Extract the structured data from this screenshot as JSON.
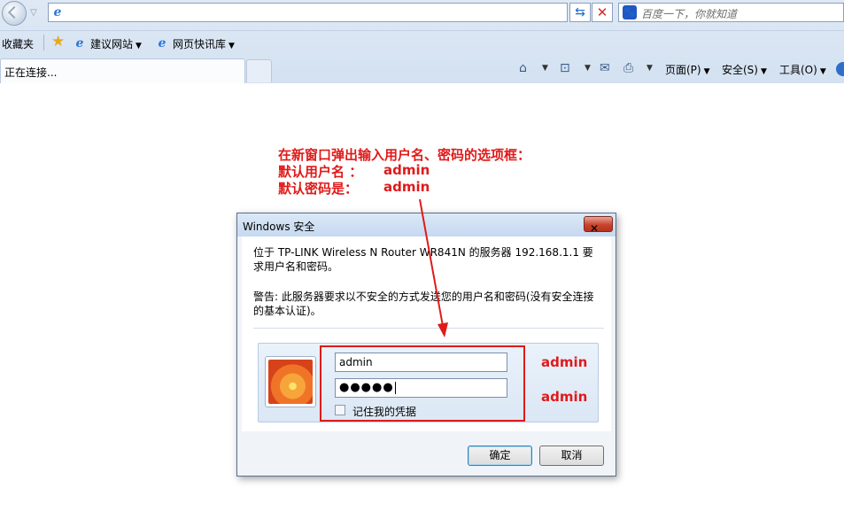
{
  "browser": {
    "address_value": "",
    "search_placeholder": "百度一下，你就知道",
    "favorites": {
      "favorites_label": "收藏夹",
      "items": [
        "建议网站",
        "网页快讯库"
      ]
    },
    "tab_label": "正在连接...",
    "command_bar": {
      "page_label": "页面(P)",
      "safety_label": "安全(S)",
      "tools_label": "工具(O)"
    }
  },
  "annotation": {
    "line1": "在新窗口弹出输入用户名、密码的选项框：",
    "line2_label": "默认用户名 ：",
    "line2_value": "admin",
    "line3_label": "默认密码是：",
    "line3_value": "admin",
    "username_note": "admin",
    "password_note": "admin",
    "color": "#e01a1a"
  },
  "dialog": {
    "title": "Windows 安全",
    "message1": "位于 TP-LINK Wireless N Router WR841N 的服务器 192.168.1.1 要求用户名和密码。",
    "message2": "警告: 此服务器要求以不安全的方式发送您的用户名和密码(没有安全连接的基本认证)。",
    "username_value": "admin",
    "password_value": "●●●●●",
    "remember_label": "记住我的凭据",
    "remember_checked": false,
    "ok_label": "确定",
    "cancel_label": "取消"
  }
}
